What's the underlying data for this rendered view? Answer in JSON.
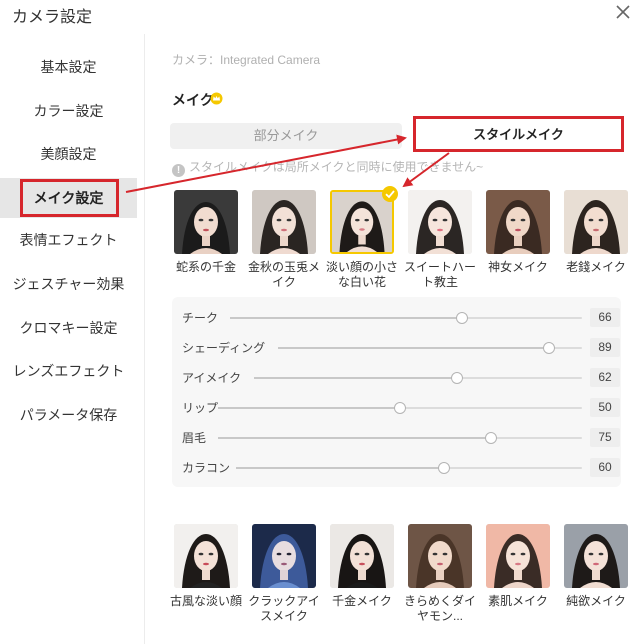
{
  "window": {
    "title": "カメラ設定"
  },
  "sidebar": {
    "items": [
      {
        "label": "基本設定"
      },
      {
        "label": "カラー設定"
      },
      {
        "label": "美顔設定"
      },
      {
        "label": "メイク設定"
      },
      {
        "label": "表情エフェクト"
      },
      {
        "label": "ジェスチャー効果"
      },
      {
        "label": "クロマキー設定"
      },
      {
        "label": "レンズエフェクト"
      },
      {
        "label": "パラメータ保存"
      }
    ],
    "active_index": 3
  },
  "main": {
    "camera_label": "カメラ：Integrated Camera",
    "section_title": "メイク",
    "tabs": [
      {
        "label": "部分メイク"
      },
      {
        "label": "スタイルメイク"
      }
    ],
    "active_tab": 1,
    "warning": "スタイルメイクは局所メイクと同時に使用できません~",
    "styles_row1": [
      {
        "caption": "蛇系の千金",
        "selected": false
      },
      {
        "caption": "金秋の玉兎メイク",
        "selected": false
      },
      {
        "caption": "淡い顔の小さな白い花",
        "selected": true
      },
      {
        "caption": "スイートハート教主",
        "selected": false
      },
      {
        "caption": "神女メイク",
        "selected": false
      },
      {
        "caption": "老錢メイク",
        "selected": false
      }
    ],
    "sliders": [
      {
        "label": "チーク",
        "value": 66
      },
      {
        "label": "シェーディング",
        "value": 89
      },
      {
        "label": "アイメイク",
        "value": 62
      },
      {
        "label": "リップ",
        "value": 50
      },
      {
        "label": "眉毛",
        "value": 75
      },
      {
        "label": "カラコン",
        "value": 60
      }
    ],
    "styles_row2": [
      {
        "caption": "古風な淡い顔"
      },
      {
        "caption": "クラックアイスメイク"
      },
      {
        "caption": "千金メイク"
      },
      {
        "caption": "きらめくダイヤモン..."
      },
      {
        "caption": "素肌メイク"
      },
      {
        "caption": "純欲メイク"
      }
    ]
  },
  "colors": {
    "annotation_red": "#d6262c",
    "selected_border": "#f5c800",
    "active_nav_bg": "#e6e6e6"
  }
}
